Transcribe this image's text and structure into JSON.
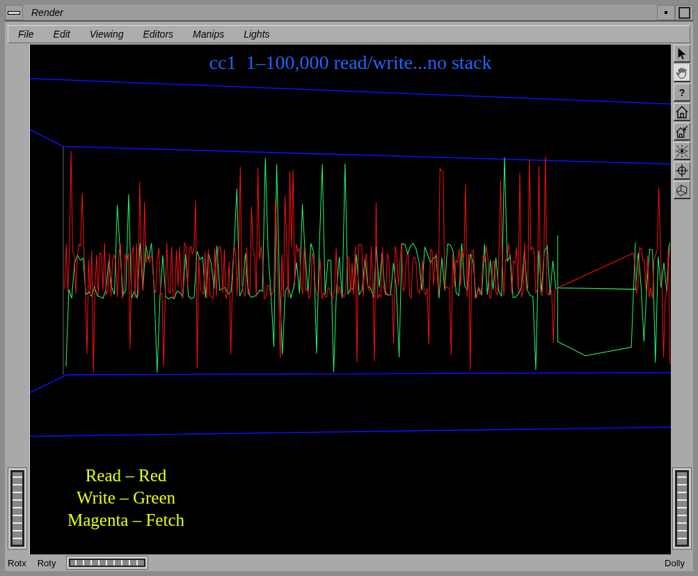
{
  "window": {
    "title": "Render"
  },
  "menu": [
    "File",
    "Edit",
    "Viewing",
    "Editors",
    "Manips",
    "Lights"
  ],
  "viewport": {
    "title": "cc1  1–100,000 read/write...no stack",
    "legend": [
      "Read – Red",
      "Write – Green",
      "Magenta – Fetch"
    ]
  },
  "tools": [
    {
      "kind": "pointer",
      "selected": false
    },
    {
      "kind": "hand",
      "selected": true
    },
    {
      "kind": "help",
      "label": "?",
      "selected": false
    },
    {
      "kind": "home",
      "selected": false
    },
    {
      "kind": "set-home",
      "selected": false
    },
    {
      "kind": "view-all",
      "selected": false
    },
    {
      "kind": "seek",
      "selected": false
    },
    {
      "kind": "projection",
      "selected": false
    }
  ],
  "bottom_bar": {
    "left_labels": [
      "Rotx",
      "Roty"
    ],
    "right_label": "Dolly"
  }
}
